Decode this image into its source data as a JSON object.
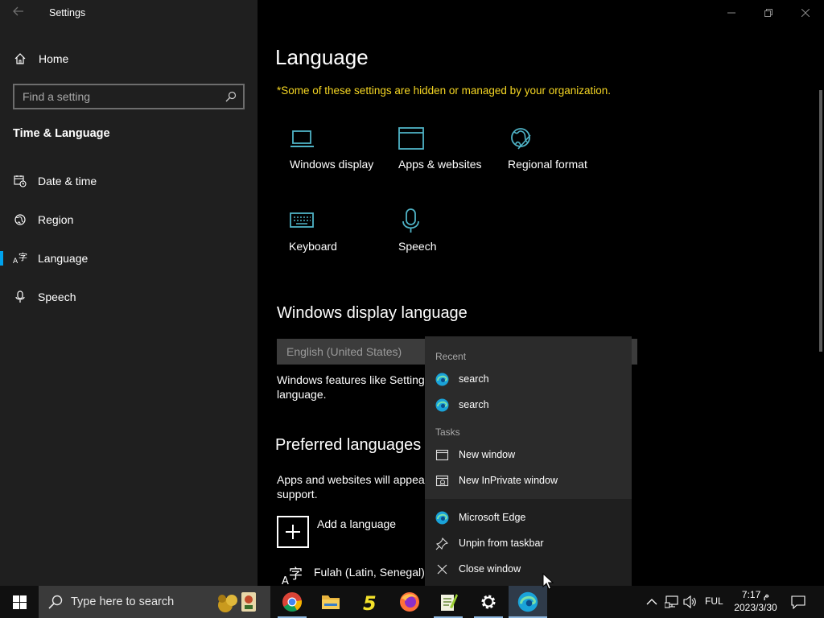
{
  "window": {
    "app_title": "Settings",
    "controls": {
      "minimize": "—",
      "maximize": "❐",
      "close": "✕"
    }
  },
  "sidebar": {
    "home_label": "Home",
    "search_placeholder": "Find a setting",
    "section_heading": "Time & Language",
    "items": [
      {
        "label": "Date & time",
        "icon": "clock-calendar-icon",
        "selected": false
      },
      {
        "label": "Region",
        "icon": "globe-icon",
        "selected": false
      },
      {
        "label": "Language",
        "icon": "language-icon",
        "selected": true
      },
      {
        "label": "Speech",
        "icon": "microphone-icon",
        "selected": false
      }
    ]
  },
  "main": {
    "title": "Language",
    "org_notice": "*Some of these settings are hidden or managed by your organization.",
    "related_tiles": [
      {
        "label": "Windows display",
        "icon": "laptop-icon"
      },
      {
        "label": "Apps & websites",
        "icon": "browser-window-icon"
      },
      {
        "label": "Regional format",
        "icon": "globe-format-icon"
      },
      {
        "label": "Keyboard",
        "icon": "keyboard-icon"
      },
      {
        "label": "Speech",
        "icon": "microphone-icon"
      }
    ],
    "display_language": {
      "heading": "Windows display language",
      "selected_value": "English (United States)",
      "description": "Windows features like Settings language."
    },
    "preferred_languages": {
      "heading": "Preferred languages",
      "description": "Apps and websites will appear support.",
      "add_label": "Add a language",
      "languages": [
        {
          "name": "Fulah (Latin, Senegal)"
        }
      ]
    }
  },
  "jumplist": {
    "recent_header": "Recent",
    "recent_items": [
      {
        "label": "search"
      },
      {
        "label": "search"
      }
    ],
    "tasks_header": "Tasks",
    "tasks": [
      {
        "label": "New window",
        "icon": "window-icon"
      },
      {
        "label": "New InPrivate window",
        "icon": "inprivate-window-icon"
      }
    ],
    "app_actions": [
      {
        "label": "Microsoft Edge",
        "icon": "edge-icon"
      },
      {
        "label": "Unpin from taskbar",
        "icon": "unpin-icon"
      },
      {
        "label": "Close window",
        "icon": "close-icon"
      }
    ]
  },
  "taskbar": {
    "search_text": "Type here to search",
    "apps": [
      {
        "name": "Google Chrome",
        "icon": "chrome-icon"
      },
      {
        "name": "File Explorer",
        "icon": "folder-icon"
      },
      {
        "name": "5",
        "icon": "five-app-icon"
      },
      {
        "name": "Firefox",
        "icon": "firefox-icon"
      },
      {
        "name": "Notepad++",
        "icon": "notepad-icon"
      },
      {
        "name": "Settings",
        "icon": "gear-icon"
      },
      {
        "name": "Microsoft Edge",
        "icon": "edge-icon"
      }
    ],
    "tray": {
      "language": "FUL",
      "time": "7:17 م",
      "date": "2023/3/30"
    }
  },
  "colors": {
    "accent": "#00a2ed",
    "tile_icon": "#4fb3c6",
    "notice": "#f5d623",
    "sidebar_bg": "#1f1f1f",
    "main_bg": "#000000"
  }
}
